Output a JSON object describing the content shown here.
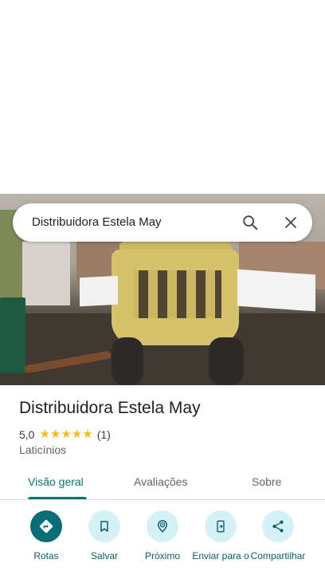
{
  "search": {
    "query": "Distribuidora Estela May"
  },
  "place": {
    "name": "Distribuidora Estela May",
    "rating": "5,0",
    "stars": "★★★★★",
    "review_count": "(1)",
    "category": "Laticínios"
  },
  "tabs": [
    {
      "label": "Visão geral",
      "active": true
    },
    {
      "label": "Avaliações",
      "active": false
    },
    {
      "label": "Sobre",
      "active": false
    }
  ],
  "actions": [
    {
      "label": "Rotas",
      "icon": "directions-icon"
    },
    {
      "label": "Salvar",
      "icon": "bookmark-icon"
    },
    {
      "label": "Próximo",
      "icon": "nearby-icon"
    },
    {
      "label": "Enviar para o",
      "icon": "send-to-phone-icon"
    },
    {
      "label": "Compartilhar",
      "icon": "share-icon"
    }
  ],
  "colors": {
    "accent": "#00796b",
    "primary_button": "#0b6d75",
    "action_bg": "#d3f1f6",
    "star": "#fbbc04"
  }
}
